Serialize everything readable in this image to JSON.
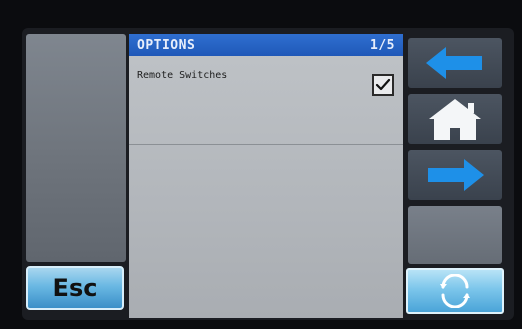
{
  "header": {
    "title": "OPTIONS",
    "page_indicator": "1/5"
  },
  "options": [
    {
      "label": "Remote Switches",
      "checked": true
    }
  ],
  "buttons": {
    "esc_label": "Esc",
    "back_icon": "arrow-left-icon",
    "home_icon": "home-icon",
    "next_icon": "arrow-right-icon",
    "refresh_icon": "refresh-icon"
  },
  "colors": {
    "header_bg": "#1f58b8",
    "accent": "#3a8fc8",
    "arrow": "#1e90e8"
  }
}
